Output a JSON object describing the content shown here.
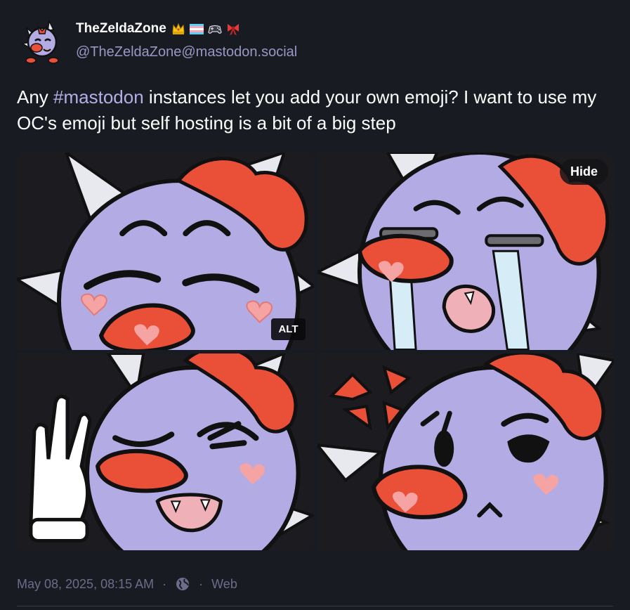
{
  "author": {
    "display_name": "TheZeldaZone",
    "handle": "@TheZeldaZone@mastodon.social",
    "badges": [
      "crown-emoji",
      "trans-flag-emoji",
      "gamepad-emoji",
      "ribbon-emoji"
    ]
  },
  "post": {
    "text_before": "Any ",
    "hashtag": "#mastodon",
    "text_after": " instances let you add your own emoji? I want to use my OC's emoji but self hosting is a bit of a big step"
  },
  "media": {
    "hide_label": "Hide",
    "alt_label": "ALT",
    "images": [
      {
        "expression": "content-smile-emoji"
      },
      {
        "expression": "crying-emoji"
      },
      {
        "expression": "waving-wink-emoji"
      },
      {
        "expression": "angry-emoji"
      }
    ]
  },
  "meta": {
    "timestamp": "May 08, 2025, 08:15 AM",
    "separator": "·",
    "visibility_icon": "globe-icon",
    "application": "Web"
  },
  "colors": {
    "background": "#191b22",
    "hashtag": "#b3afe6",
    "handle": "#9a97c4",
    "muted": "#6e6c8a",
    "character_body": "#b3abe3",
    "nose": "#ea4f37",
    "bow": "#ea4f37"
  }
}
